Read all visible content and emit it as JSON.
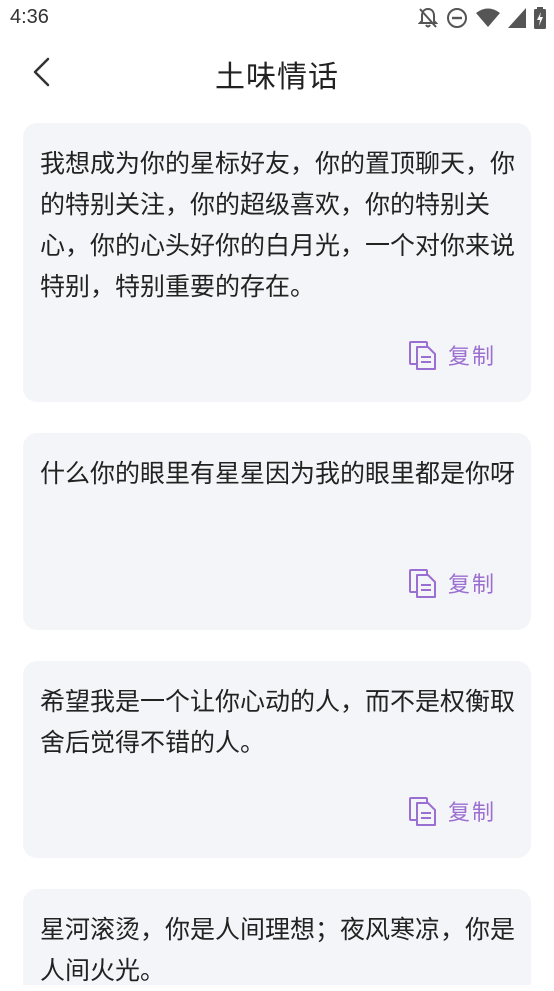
{
  "status_bar": {
    "time": "4:36",
    "icons": [
      "notifications-off-icon",
      "do-not-disturb-icon",
      "wifi-icon",
      "cellular-signal-icon",
      "battery-icon"
    ]
  },
  "header": {
    "title": "土味情话",
    "back_icon": "chevron-left-icon"
  },
  "copy_label": "复制",
  "colors": {
    "accent": "#9b6fd1",
    "card_background": "#f4f5f8",
    "text": "#222222"
  },
  "cards": [
    {
      "text": "我想成为你的星标好友，你的置顶聊天，你的特别关注，你的超级喜欢，你的特别关心，你的心头好你的白月光，一个对你来说特别，特别重要的存在。"
    },
    {
      "text": "什么你的眼里有星星因为我的眼里都是你呀"
    },
    {
      "text": "希望我是一个让你心动的人，而不是权衡取舍后觉得不错的人。"
    },
    {
      "text": "星河滚烫，你是人间理想；夜风寒凉，你是人间火光。"
    }
  ]
}
